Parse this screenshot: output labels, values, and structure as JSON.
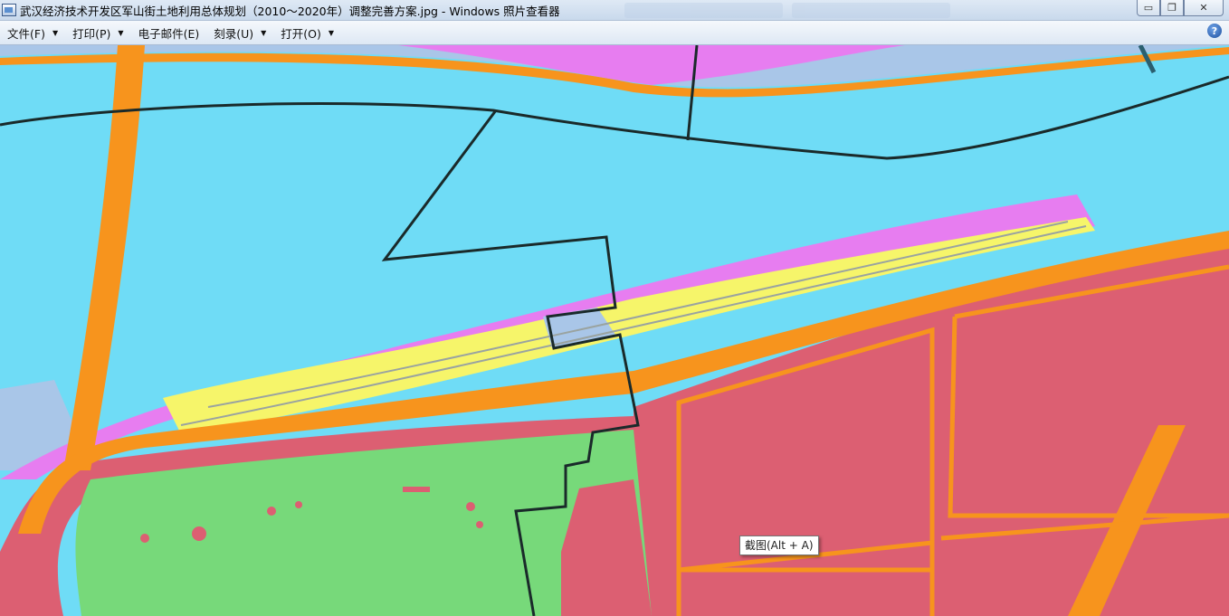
{
  "window": {
    "title": "武汉经济技术开发区军山街土地利用总体规划（2010～2020年）调整完善方案.jpg - Windows 照片查看器",
    "min_glyph": "▭",
    "max_glyph": "❐",
    "close_glyph": "✕"
  },
  "menu": {
    "items": [
      {
        "label": "文件(F)",
        "has_dropdown": true
      },
      {
        "label": "打印(P)",
        "has_dropdown": true
      },
      {
        "label": "电子邮件(E)",
        "has_dropdown": false
      },
      {
        "label": "刻录(U)",
        "has_dropdown": true
      },
      {
        "label": "打开(O)",
        "has_dropdown": true
      }
    ],
    "dropdown_glyph": "▼",
    "help_glyph": "?"
  },
  "tooltip": {
    "text": "截图(Alt + A)"
  },
  "map_colors": {
    "water": "#6fdcf6",
    "urban": "#dc5f72",
    "road": "#f7941d",
    "farmland": "#f6f56a",
    "green": "#77d97a",
    "magenta": "#e77df0",
    "boundary": "#1a2a2a"
  }
}
